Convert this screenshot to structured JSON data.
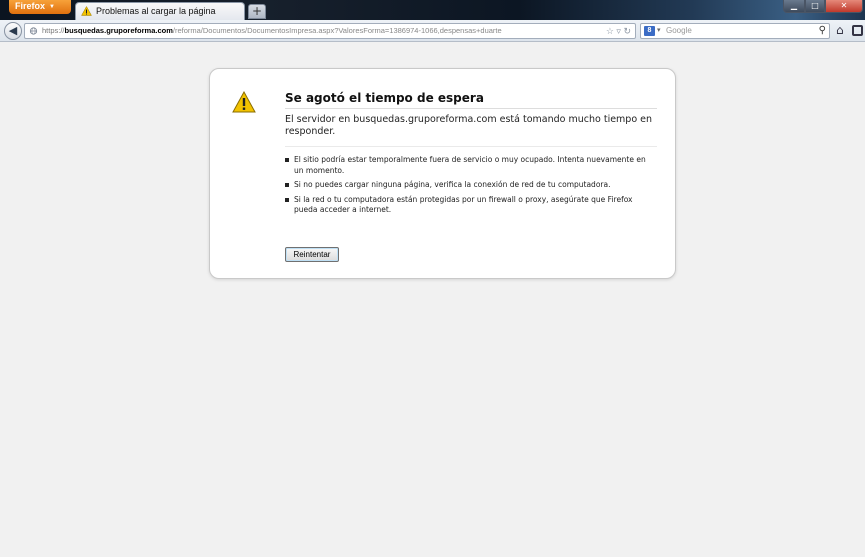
{
  "browser": {
    "app_button_label": "Firefox",
    "tab_title": "Problemas al cargar la página",
    "new_tab_label": "+",
    "url_protocol": "https://",
    "url_host": "busquedas.gruporeforma.com",
    "url_path": "/reforma/Documentos/DocumentosImpresa.aspx?ValoresForma=1386974-1066,despensas+duarte",
    "search_placeholder": "Google",
    "icons": [
      "warning-icon",
      "back-arrow-icon",
      "globe-icon",
      "star-icon",
      "reload-icon",
      "google-icon",
      "search-icon",
      "home-icon",
      "bookmarks-icon"
    ]
  },
  "error_page": {
    "title": "Se agotó el tiempo de espera",
    "description": "El servidor en busquedas.gruporeforma.com está tomando mucho tiempo en responder.",
    "suggestions": [
      "El sitio podría estar temporalmente fuera de servicio o muy ocupado. Intenta nuevamente en un momento.",
      "Si no puedes cargar ninguna página, verifica la conexión de red de tu computadora.",
      "Si la red o tu computadora están protegidas por un firewall o proxy, asegúrate que Firefox pueda acceder a internet."
    ],
    "retry_label": "Reintentar"
  },
  "colors": {
    "firefox_orange": "#e0700e",
    "warning_yellow": "#f2c200",
    "page_background": "#f1f1f1"
  }
}
